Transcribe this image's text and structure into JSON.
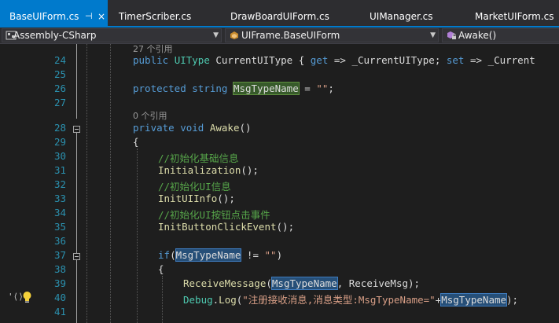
{
  "tabs": [
    {
      "label": "BaseUIForm.cs",
      "active": true,
      "pin": "⊣",
      "close": "×"
    },
    {
      "label": "TimerScriber.cs",
      "active": false
    },
    {
      "label": "DrawBoardUIForm.cs",
      "active": false
    },
    {
      "label": "UIManager.cs",
      "active": false
    },
    {
      "label": "MarketUIForm.cs",
      "active": false
    }
  ],
  "nav": {
    "project": "Assembly-CSharp",
    "class": "UIFrame.BaseUIForm",
    "member": "Awake()"
  },
  "codelens": {
    "line24": "27 个引用",
    "line28": "0 个引用"
  },
  "lines": {
    "l24": {
      "num": "24",
      "t1": "public",
      "t2": "UIType",
      "t3": " CurrentUIType { ",
      "t4": "get",
      "t5": " => _CurrentUIType; ",
      "t6": "set",
      "t7": " => _Current"
    },
    "l25": {
      "num": "25"
    },
    "l26": {
      "num": "26",
      "t1": "protected",
      "t2": "string",
      "t3": "MsgTypeName",
      "t4": " = ",
      "t5": "\"\"",
      "t6": ";"
    },
    "l27": {
      "num": "27"
    },
    "l28": {
      "num": "28",
      "t1": "private",
      "t2": "void",
      "t3": "Awake",
      "t4": "()"
    },
    "l29": {
      "num": "29",
      "t1": "{"
    },
    "l30": {
      "num": "30",
      "t1": "//初始化基础信息"
    },
    "l31": {
      "num": "31",
      "t1": "Initialization",
      "t2": "();"
    },
    "l32": {
      "num": "32",
      "t1": "//初始化UI信息"
    },
    "l33": {
      "num": "33",
      "t1": "InitUIInfo",
      "t2": "();"
    },
    "l34": {
      "num": "34",
      "t1": "//初始化UI按钮点击事件"
    },
    "l35": {
      "num": "35",
      "t1": "InitButtonClickEvent",
      "t2": "();"
    },
    "l36": {
      "num": "36"
    },
    "l37": {
      "num": "37",
      "t1": "if",
      "t2": "(",
      "t3": "MsgTypeName",
      "t4": " != ",
      "t5": "\"\"",
      "t6": ")"
    },
    "l38": {
      "num": "38",
      "t1": "{"
    },
    "l39": {
      "num": "39",
      "t1": "ReceiveMessage",
      "t2": "(",
      "t3": "MsgTypeName",
      "t4": ", ReceiveMsg);"
    },
    "l40": {
      "num": "40",
      "t1": "Debug",
      "t2": ".",
      "t3": "Log",
      "t4": "(",
      "t5": "\"注册接收消息,消息类型:MsgTypeName=\"",
      "t6": "+",
      "t7": "MsgTypeName",
      "t8": ");"
    },
    "l41": {
      "num": "41"
    }
  },
  "gutter": {
    "quick_action": "'⟨⟩"
  },
  "colors": {
    "accent": "#007acc",
    "keyword": "#569cd6",
    "type": "#4ec9b0",
    "string": "#d69d85",
    "comment": "#57a64a",
    "method": "#dcdcaa",
    "line_number": "#2b91af"
  }
}
